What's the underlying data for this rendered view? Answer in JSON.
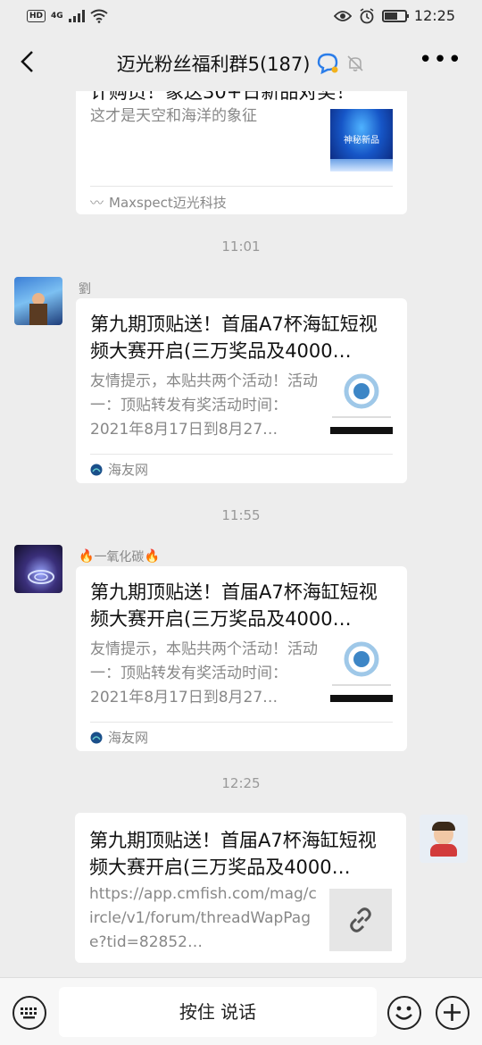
{
  "status_bar": {
    "hd": "HD",
    "network": "4G",
    "time": "12:25"
  },
  "nav": {
    "title": "迈光粉丝福利群5(187)"
  },
  "messages": [
    {
      "title_partial": "计购员！象送30+日新品对奖！",
      "desc": "这才是天空和海洋的象征",
      "thumb_text": "神秘新品",
      "source": "Maxspect迈光科技"
    },
    {
      "time": "11:01",
      "sender": "劉",
      "title": "第九期顶贴送！首届A7杯海缸短视频大赛开启(三万奖品及4000…",
      "desc": "友情提示，本贴共两个活动！活动一：顶贴转发有奖活动时间：2021年8月17日到8月27…",
      "source": "海友网"
    },
    {
      "time": "11:55",
      "sender": "一氧化碳",
      "title": "第九期顶贴送！首届A7杯海缸短视频大赛开启(三万奖品及4000…",
      "desc": "友情提示，本贴共两个活动！活动一：顶贴转发有奖活动时间：2021年8月17日到8月27…",
      "source": "海友网"
    },
    {
      "time": "12:25",
      "title": "第九期顶贴送！首届A7杯海缸短视频大赛开启(三万奖品及4000…",
      "desc": "https://app.cmfish.com/mag/circle/v1/forum/threadWapPage?tid=82852…"
    }
  ],
  "input_bar": {
    "hold_to_talk": "按住 说话"
  }
}
